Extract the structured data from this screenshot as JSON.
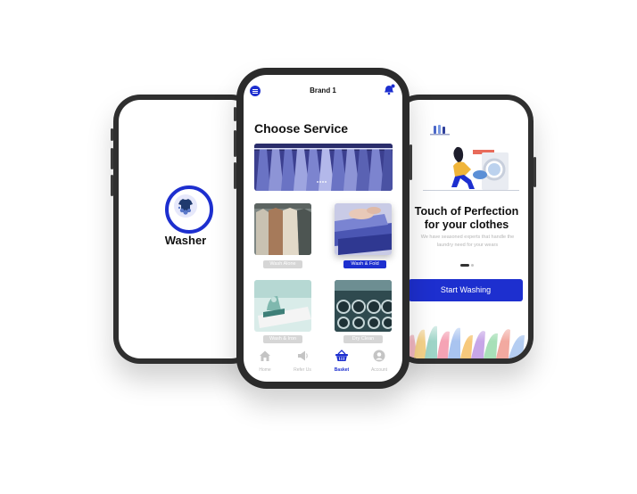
{
  "splash": {
    "app_name": "Washer"
  },
  "service": {
    "header": {
      "title": "Brand 1"
    },
    "section_title": "Choose Service",
    "banner_dot_count": 4,
    "tiles": [
      {
        "label": "Wash Alone",
        "selected": false
      },
      {
        "label": "Wash & Fold",
        "selected": true
      },
      {
        "label": "Wash & Iron",
        "selected": false
      },
      {
        "label": "Dry Clean",
        "selected": false
      }
    ],
    "tabs": [
      {
        "label": "Home",
        "icon": "home-icon",
        "active": false
      },
      {
        "label": "Refer Us",
        "icon": "megaphone-icon",
        "active": false
      },
      {
        "label": "Basket",
        "icon": "basket-icon",
        "active": true
      },
      {
        "label": "Account",
        "icon": "account-icon",
        "active": false
      }
    ]
  },
  "onboarding": {
    "title_line1": "Touch of Perfection",
    "title_line2": "for your clothes",
    "description": "We have seasoned experts that handle the laundry need for your wears",
    "cta": "Start Washing"
  },
  "colors": {
    "accent": "#1d2fcf",
    "inactive": "#d6d6d6",
    "muted_text": "#b5b5b5"
  }
}
